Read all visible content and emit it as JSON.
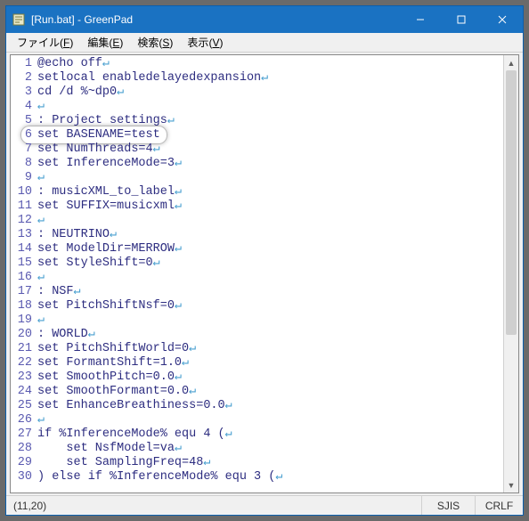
{
  "window": {
    "title": "[Run.bat] - GreenPad"
  },
  "menu": {
    "file": {
      "label": "ファイル",
      "accel": "F"
    },
    "edit": {
      "label": "編集",
      "accel": "E"
    },
    "search": {
      "label": "検索",
      "accel": "S"
    },
    "view": {
      "label": "表示",
      "accel": "V"
    }
  },
  "lines": [
    {
      "n": "1",
      "t": "@echo off"
    },
    {
      "n": "2",
      "t": "setlocal enabledelayedexpansion"
    },
    {
      "n": "3",
      "t": "cd /d %~dp0"
    },
    {
      "n": "4",
      "t": ""
    },
    {
      "n": "5",
      "t": ": Project settings"
    },
    {
      "n": "6",
      "t": "set BASENAME=test",
      "hl": true
    },
    {
      "n": "7",
      "t": "set NumThreads=4"
    },
    {
      "n": "8",
      "t": "set InferenceMode=3"
    },
    {
      "n": "9",
      "t": ""
    },
    {
      "n": "10",
      "t": ": musicXML_to_label"
    },
    {
      "n": "11",
      "t": "set SUFFIX=musicxml"
    },
    {
      "n": "12",
      "t": ""
    },
    {
      "n": "13",
      "t": ": NEUTRINO"
    },
    {
      "n": "14",
      "t": "set ModelDir=MERROW"
    },
    {
      "n": "15",
      "t": "set StyleShift=0"
    },
    {
      "n": "16",
      "t": ""
    },
    {
      "n": "17",
      "t": ": NSF"
    },
    {
      "n": "18",
      "t": "set PitchShiftNsf=0"
    },
    {
      "n": "19",
      "t": ""
    },
    {
      "n": "20",
      "t": ": WORLD"
    },
    {
      "n": "21",
      "t": "set PitchShiftWorld=0"
    },
    {
      "n": "22",
      "t": "set FormantShift=1.0"
    },
    {
      "n": "23",
      "t": "set SmoothPitch=0.0"
    },
    {
      "n": "24",
      "t": "set SmoothFormant=0.0"
    },
    {
      "n": "25",
      "t": "set EnhanceBreathiness=0.0"
    },
    {
      "n": "26",
      "t": ""
    },
    {
      "n": "27",
      "t": "if %InferenceMode% equ 4 ("
    },
    {
      "n": "28",
      "t": "    set NsfModel=va"
    },
    {
      "n": "29",
      "t": "    set SamplingFreq=48"
    },
    {
      "n": "30",
      "t": ") else if %InferenceMode% equ 3 ("
    }
  ],
  "status": {
    "pos": "(11,20)",
    "encoding": "SJIS",
    "eol": "CRLF"
  },
  "newline_mark": "↵"
}
